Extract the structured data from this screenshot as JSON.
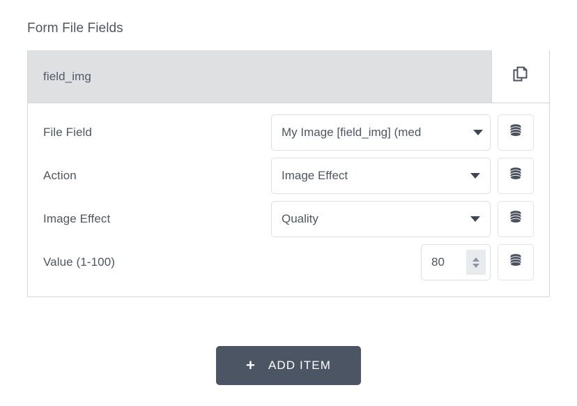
{
  "section": {
    "title": "Form File Fields"
  },
  "card": {
    "header": {
      "title": "field_img",
      "duplicate_icon": "copy-icon"
    },
    "rows": [
      {
        "label": "File Field",
        "control": "select",
        "value": "My Image [field_img] (med",
        "token_icon": "database-icon"
      },
      {
        "label": "Action",
        "control": "select",
        "value": "Image Effect",
        "token_icon": "database-icon"
      },
      {
        "label": "Image Effect",
        "control": "select",
        "value": "Quality",
        "token_icon": "database-icon"
      },
      {
        "label": "Value (1-100)",
        "control": "number",
        "value": "80",
        "token_icon": "database-icon"
      }
    ]
  },
  "footer": {
    "add_item_label": "ADD ITEM",
    "add_item_plus": "+"
  },
  "colors": {
    "header_strip": "#dfe0e1",
    "text": "#4e5663",
    "border": "#d4d6db",
    "button_bg": "#4b5563",
    "spinner_bg": "#e8eaee"
  }
}
